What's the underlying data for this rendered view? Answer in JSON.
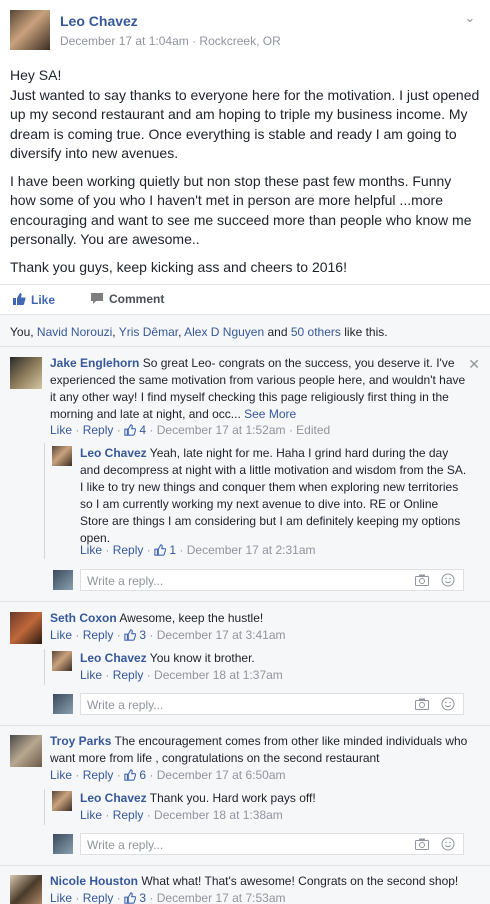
{
  "post": {
    "author": "Leo Chavez",
    "meta": "December 17 at 1:04am · Rockcreek, OR",
    "paragraphs": [
      "Hey SA!\nJust wanted to say thanks to everyone here for the motivation. I just opened up my second restaurant and am hoping to triple my business income. My dream is coming true. Once everything is stable and ready I am going to diversify into new avenues.",
      "I have been working quietly but non stop these past few months. Funny how some of you who I haven't met in person are more helpful ...more encouraging and want to see me succeed more than people who know me personally. You are awesome..",
      "Thank you guys, keep kicking ass and cheers to 2016!"
    ]
  },
  "actions": {
    "like": "Like",
    "comment": "Comment"
  },
  "likes": {
    "you": "You, ",
    "names": [
      "Navid Norouzi",
      "Yris Dêmar",
      "Alex D Nguyen"
    ],
    "and": " and ",
    "others": "50 others",
    "suffix": " like this."
  },
  "colors": {
    "link": "#365899",
    "accent": "#4267b2",
    "meta": "#90949c",
    "feedback_bg": "#f6f7f9"
  },
  "comments": [
    {
      "name": "Jake Englehorn",
      "text": " So great Leo- congrats on the success, you deserve it. I've experienced the same motivation from various people here, and wouldn't have it any other way! I find myself checking this page religiously first thing in the morning and late at night, and occ...",
      "see_more": " See More",
      "like": "Like",
      "reply": "Reply",
      "likes": "4",
      "time": "December 17 at 1:52am",
      "edited": "Edited",
      "reply_item": {
        "name": "Leo Chavez",
        "text": " Yeah, late night for me. Haha I grind hard during the day and decompress at night with a little motivation and wisdom from the SA. I like to try new things and conquer them when exploring new territories so I am currently working my next avenue to dive into. RE or Online Store are things I am considering but I am definitely keeping my options open.",
        "like": "Like",
        "reply": "Reply",
        "likes": "1",
        "time": "December 17 at 2:31am"
      }
    },
    {
      "name": "Seth Coxon",
      "text": " Awesome, keep the hustle!",
      "like": "Like",
      "reply": "Reply",
      "likes": "3",
      "time": "December 17 at 3:41am",
      "reply_item": {
        "name": "Leo Chavez",
        "text": " You know it brother.",
        "like": "Like",
        "reply": "Reply",
        "time": "December 18 at 1:37am"
      }
    },
    {
      "name": "Troy Parks",
      "text": " The encouragement comes from other like minded individuals who want more from life , congratulations on the second restaurant",
      "like": "Like",
      "reply": "Reply",
      "likes": "6",
      "time": "December 17 at 6:50am",
      "reply_item": {
        "name": "Leo Chavez",
        "text": " Thank you. Hard work pays off!",
        "like": "Like",
        "reply": "Reply",
        "time": "December 18 at 1:38am"
      }
    },
    {
      "name": "Nicole Houston",
      "text": " What what! That's awesome! Congrats on the second shop!",
      "like": "Like",
      "reply": "Reply",
      "likes": "3",
      "time": "December 17 at 7:53am"
    }
  ],
  "reply_placeholder": "Write a reply...",
  "icons": {
    "chevron": "chevron-down-icon",
    "like": "thumbs-up-icon",
    "comment": "comment-bubble-icon",
    "close": "close-icon",
    "camera": "camera-icon",
    "emoji": "smiley-icon"
  }
}
